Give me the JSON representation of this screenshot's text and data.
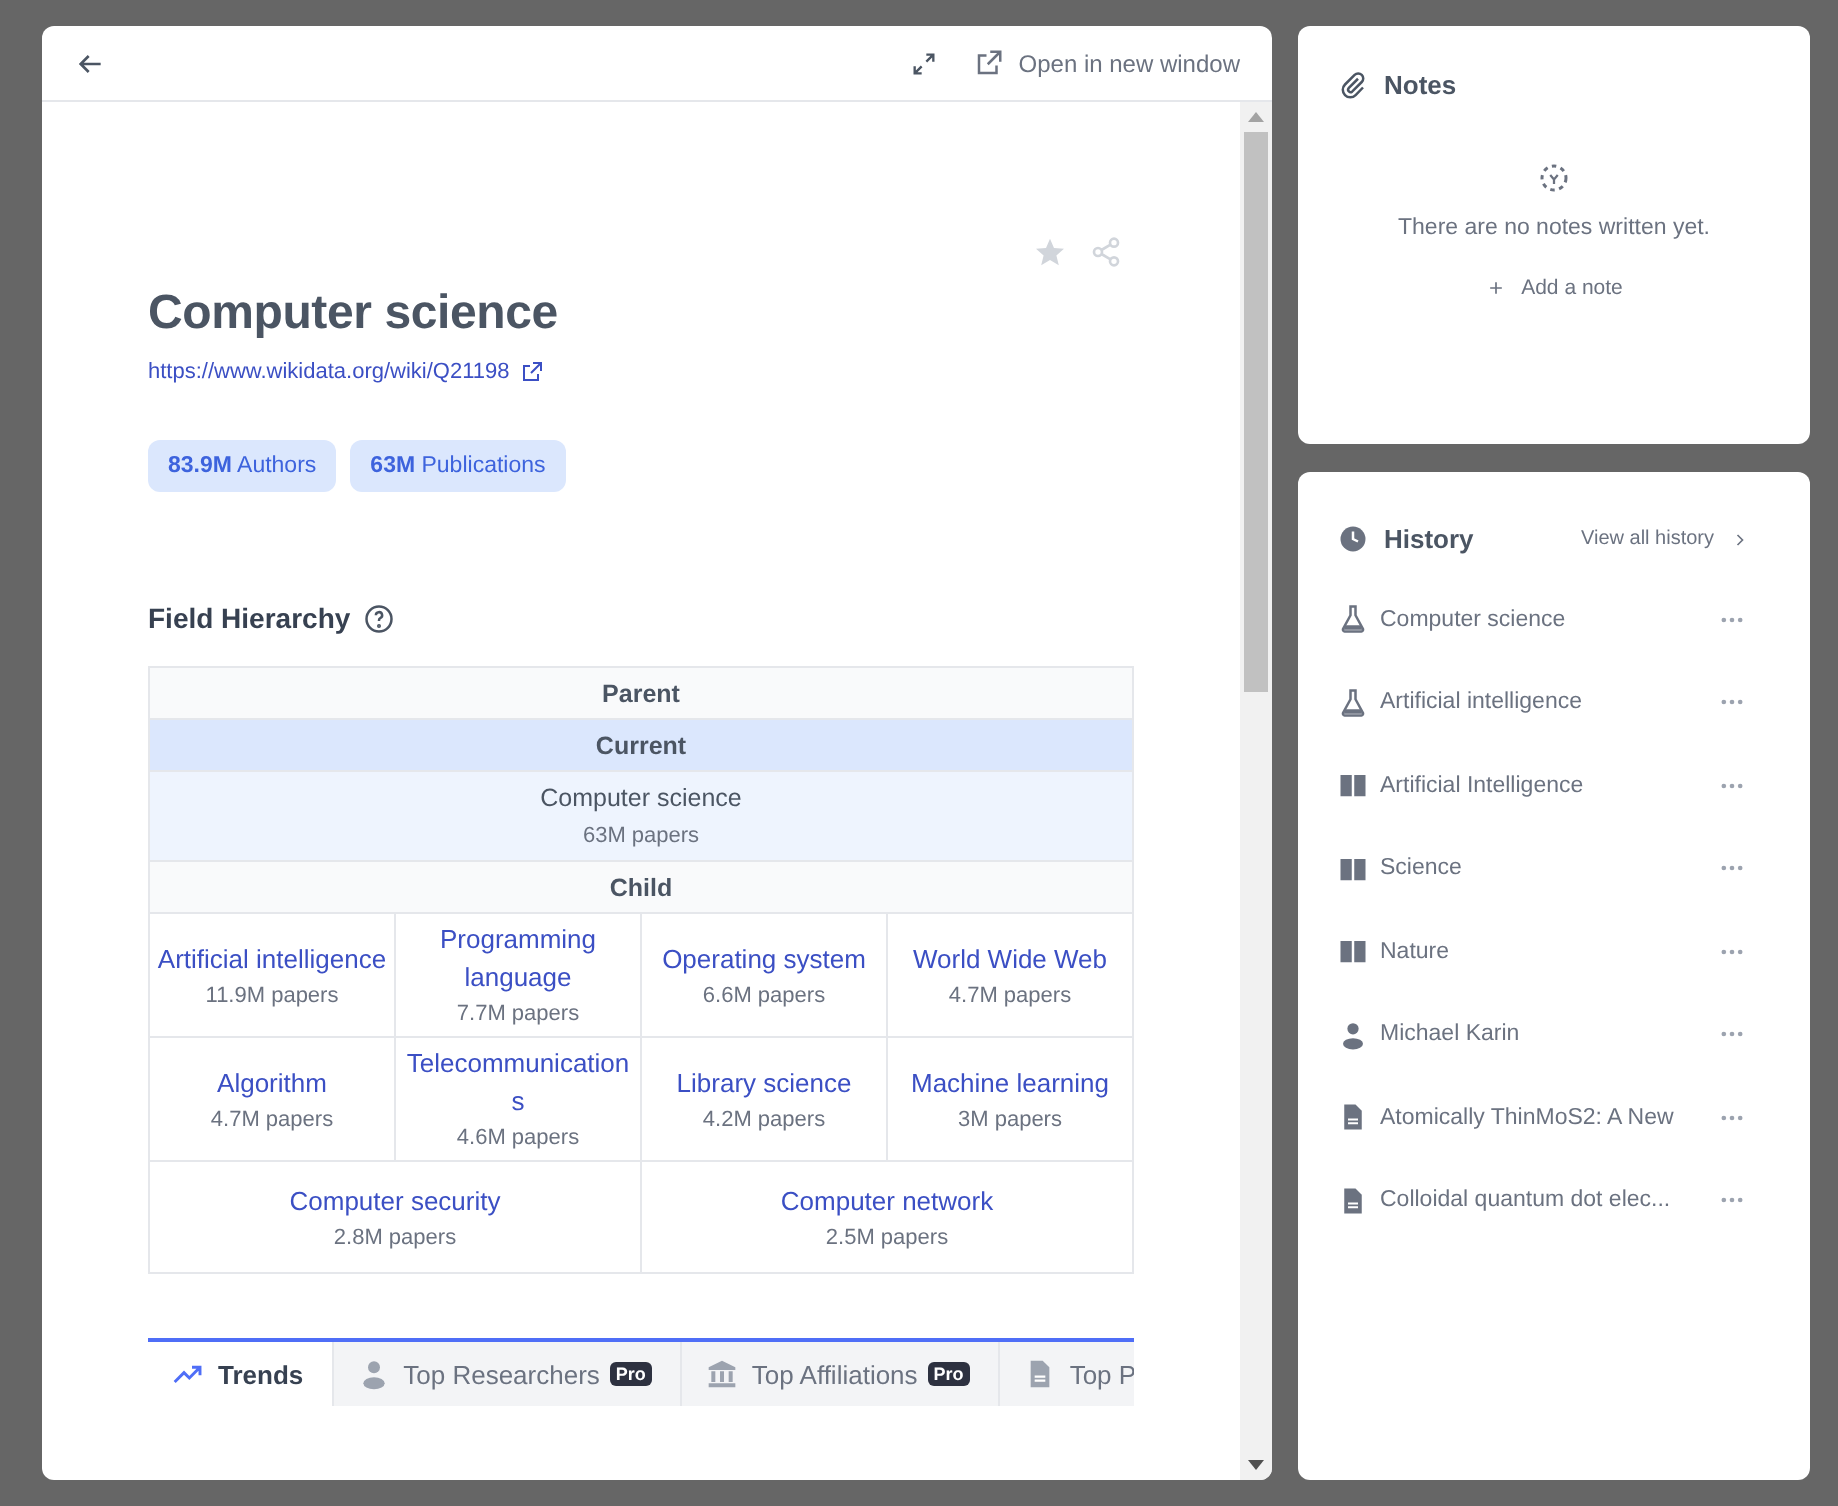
{
  "panel": {
    "open_new_window": "Open in new window",
    "title": "Computer science",
    "url": "https://www.wikidata.org/wiki/Q21198",
    "stats": [
      "**83.9M** Authors",
      "**63M** Publications"
    ],
    "hierarchy": {
      "title": "Field Hierarchy",
      "parent_label": "Parent",
      "current_label": "Current",
      "current": {
        "name": "Computer science",
        "papers": "63M papers"
      },
      "child_label": "Child",
      "child_rows": [
        [
          {
            "name": "Artificial intelligence",
            "papers": "11.9M papers"
          },
          {
            "name": "Programming language",
            "papers": "7.7M papers"
          },
          {
            "name": "Operating system",
            "papers": "6.6M papers"
          },
          {
            "name": "World Wide Web",
            "papers": "4.7M papers"
          }
        ],
        [
          {
            "name": "Algorithm",
            "papers": "4.7M papers"
          },
          {
            "name": "Telecommunications",
            "papers": "4.6M papers"
          },
          {
            "name": "Library science",
            "papers": "4.2M papers"
          },
          {
            "name": "Machine learning",
            "papers": "3M papers"
          }
        ],
        [
          {
            "name": "Computer security",
            "papers": "2.8M papers"
          },
          {
            "name": "Computer network",
            "papers": "2.5M papers"
          }
        ]
      ]
    },
    "tabs": [
      {
        "label": "Trends",
        "selected": true
      },
      {
        "label": "Top Researchers",
        "selected": false,
        "badge": "Pro"
      },
      {
        "label": "Top Affiliations",
        "selected": false,
        "badge": "Pro"
      },
      {
        "label": "Top P",
        "selected": false
      }
    ]
  },
  "notes": {
    "title": "Notes",
    "empty": "There are no notes written yet.",
    "add": "Add a note"
  },
  "history": {
    "title": "History",
    "view_all": "View all history",
    "items": [
      {
        "kind": "field",
        "label": "Computer science"
      },
      {
        "kind": "field",
        "label": "Artificial intelligence"
      },
      {
        "kind": "journal",
        "label": "Artificial Intelligence"
      },
      {
        "kind": "journal",
        "label": "Science"
      },
      {
        "kind": "journal",
        "label": "Nature"
      },
      {
        "kind": "person",
        "label": "Michael Karin"
      },
      {
        "kind": "paper",
        "label": "Atomically ThinMoS2: A New"
      },
      {
        "kind": "paper",
        "label": "Colloidal quantum dot elec..."
      }
    ]
  }
}
